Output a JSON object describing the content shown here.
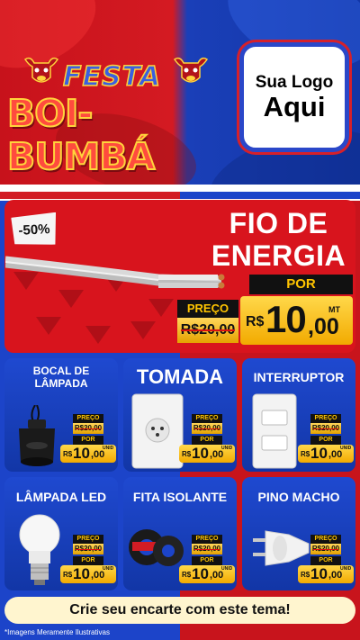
{
  "header": {
    "festa": "FESTA",
    "title": "BOI-BUMBÁ",
    "brand_line1": "Sua Logo",
    "brand_line2": "Aqui"
  },
  "hero": {
    "discount": "-50%",
    "title_line1": "FIO DE",
    "title_line2": "ENERGIA",
    "por_label": "POR",
    "preco_label": "PREÇO",
    "old_price": "R$20,00",
    "currency": "R$",
    "price_int": "10",
    "price_cents": ",00",
    "unit": "MT"
  },
  "products": [
    {
      "title": "BOCAL DE LÂMPADA",
      "preco_label": "PREÇO",
      "old_price": "R$20,00",
      "por_label": "POR",
      "currency": "R$",
      "price_int": "10",
      "price_cents": ",00",
      "unit": "UNID"
    },
    {
      "title": "TOMADA",
      "preco_label": "PREÇO",
      "old_price": "R$20,00",
      "por_label": "POR",
      "currency": "R$",
      "price_int": "10",
      "price_cents": ",00",
      "unit": "UNID"
    },
    {
      "title": "INTERRUPTOR",
      "preco_label": "PREÇO",
      "old_price": "R$20,00",
      "por_label": "POR",
      "currency": "R$",
      "price_int": "10",
      "price_cents": ",00",
      "unit": "UNID"
    },
    {
      "title": "LÂMPADA LED",
      "preco_label": "PREÇO",
      "old_price": "R$20,00",
      "por_label": "POR",
      "currency": "R$",
      "price_int": "10",
      "price_cents": ",00",
      "unit": "UNID"
    },
    {
      "title": "FITA ISOLANTE",
      "preco_label": "PREÇO",
      "old_price": "R$20,00",
      "por_label": "POR",
      "currency": "R$",
      "price_int": "10",
      "price_cents": ",00",
      "unit": "UNID"
    },
    {
      "title": "PINO MACHO",
      "preco_label": "PREÇO",
      "old_price": "R$20,00",
      "por_label": "POR",
      "currency": "R$",
      "price_int": "10",
      "price_cents": ",00",
      "unit": "UNID"
    }
  ],
  "footer": {
    "cta": "Crie seu encarte com este tema!",
    "disclaimer": "*Imagens Meramente Ilustrativas"
  },
  "colors": {
    "red": "#d8141d",
    "blue": "#1c44c9",
    "gold": "#ffc400",
    "black": "#111111"
  }
}
